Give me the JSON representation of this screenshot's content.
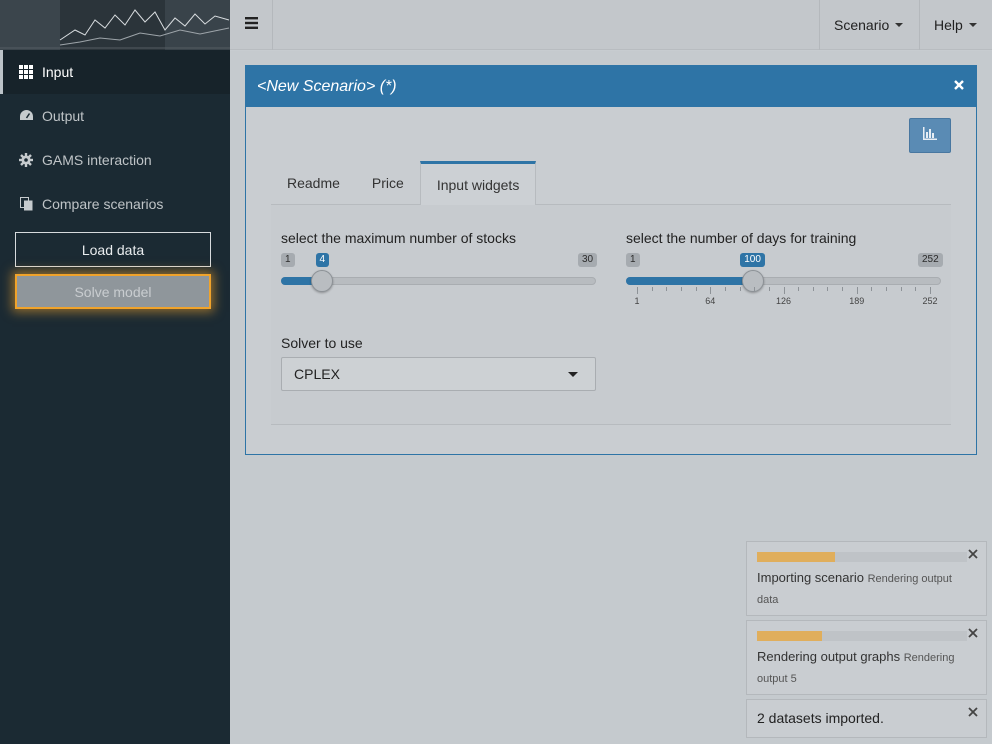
{
  "sidebar": {
    "items": [
      {
        "label": "Input",
        "icon": "grid-icon",
        "active": true
      },
      {
        "label": "Output",
        "icon": "dashboard-icon",
        "active": false
      },
      {
        "label": "GAMS interaction",
        "icon": "gear-icon",
        "active": false
      },
      {
        "label": "Compare scenarios",
        "icon": "copy-icon",
        "active": false
      }
    ],
    "load_button": "Load data",
    "solve_button": "Solve model"
  },
  "topbar": {
    "scenario_menu": "Scenario",
    "help_menu": "Help"
  },
  "scenario_box": {
    "title": "<New Scenario> (*)",
    "tabs": [
      "Readme",
      "Price",
      "Input widgets"
    ],
    "active_tab": "Input widgets",
    "slider_stocks": {
      "label": "select the maximum number of stocks",
      "min": "1",
      "max": "30",
      "value": "4",
      "value_num": 4,
      "min_num": 1,
      "max_num": 30
    },
    "slider_days": {
      "label": "select the number of days for training",
      "min": "1",
      "max": "252",
      "value": "100",
      "value_num": 100,
      "min_num": 1,
      "max_num": 252,
      "tick_labels": [
        "1",
        "64",
        "126",
        "189",
        "252"
      ]
    },
    "solver": {
      "label": "Solver to use",
      "value": "CPLEX"
    }
  },
  "notifications": [
    {
      "title": "Importing scenario",
      "detail": "Rendering output data",
      "progress": 0.37
    },
    {
      "title": "Rendering output graphs",
      "detail": "Rendering output 5",
      "progress": 0.31
    },
    {
      "message": "2 datasets imported."
    }
  ],
  "colors": {
    "accent": "#2e74a6",
    "sidebar": "#1b2a33",
    "highlight": "#f0a32b"
  }
}
